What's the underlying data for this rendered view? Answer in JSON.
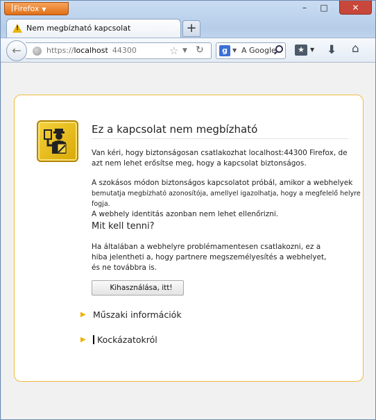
{
  "titlebar": {
    "app_menu": "Firefox",
    "minimize": "–",
    "maximize": "□",
    "close": "✕"
  },
  "tabs": [
    {
      "label": "Nem megbízható kapcsolat"
    }
  ],
  "new_tab": "+",
  "navbar": {
    "url_scheme": "https://",
    "url_host": "localhost",
    "url_port": "44300",
    "search_engine_letter": "g",
    "search_placeholder": "A Google"
  },
  "page": {
    "title": "Ez a kapcsolat nem megbízható",
    "para1": "Van kéri, hogy biztonságosan csatlakozhat localhost:44300 Firefox, de azt nem lehet erősítse meg, hogy a kapcsolat biztonságos.",
    "para2a": "A szokásos módon biztonságos kapcsolatot próbál, amikor a webhelyek",
    "para2b": "bemutatja megbízható azonosítója, amellyel igazolhatja, hogy a megfelelő helyre fogja.",
    "para2c": "A webhely identitás azonban nem lehet ellenőrizni.",
    "subtitle": "Mit kell tenni?",
    "para3": "Ha általában a webhelyre problémamentesen csatlakozni, ez a hiba jelentheti a, hogy partnere megszemélyesítés a webhelyet, és ne továbbra is.",
    "button": "Kihasználása, itt!",
    "expander1": "Műszaki információk",
    "expander2": "Kockázatokról"
  },
  "colors": {
    "panel_border": "#f0bb3c",
    "badge": "#e8b90f",
    "app_button": "#e87b1e"
  }
}
